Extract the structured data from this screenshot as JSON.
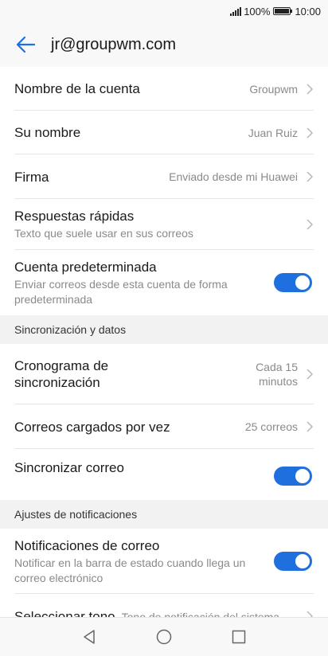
{
  "status": {
    "battery": "100%",
    "time": "10:00",
    "battery_level": 1.0
  },
  "header": {
    "title": "jr@groupwm.com",
    "back_icon": "arrow-left-icon"
  },
  "account": {
    "name_label": "Nombre de la cuenta",
    "name_value": "Groupwm",
    "your_name_label": "Su nombre",
    "your_name_value": "Juan Ruiz",
    "signature_label": "Firma",
    "signature_value": "Enviado desde mi Huawei",
    "quick_replies_label": "Respuestas rápidas",
    "quick_replies_sub": "Texto que suele usar en sus correos",
    "default_label": "Cuenta predeterminada",
    "default_sub": "Enviar correos desde esta cuenta de forma predeterminada",
    "default_on": true
  },
  "sync": {
    "section_label": "Sincronización y datos",
    "schedule_label": "Cronograma de sincronización",
    "schedule_value": "Cada 15 minutos",
    "loaded_label": "Correos cargados por vez",
    "loaded_value": "25 correos",
    "sync_mail_label": "Sincronizar correo",
    "sync_mail_on": true
  },
  "notifications": {
    "section_label": "Ajustes de notificaciones",
    "mail_label": "Notificaciones de correo",
    "mail_sub": "Notificar en la barra de estado cuando llega un correo electrónico",
    "mail_on": true,
    "tone_label": "Seleccionar tono",
    "tone_value": "Tono de notificación del sistema"
  },
  "accent_color": "#1f6fde"
}
